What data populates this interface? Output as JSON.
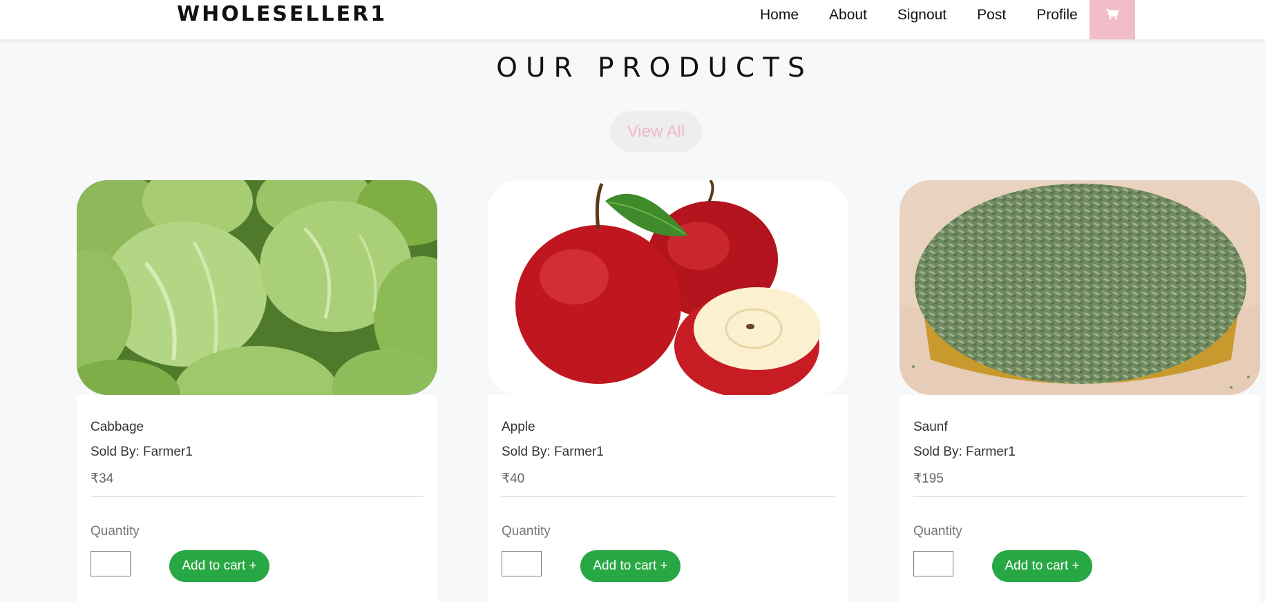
{
  "brand": "WHOLESELLER1",
  "nav": {
    "items": [
      {
        "label": "Home"
      },
      {
        "label": "About"
      },
      {
        "label": "Signout"
      },
      {
        "label": "Post"
      },
      {
        "label": "Profile"
      }
    ],
    "cart_icon": "cart-icon",
    "cart_bg": "#f2bcc8"
  },
  "section": {
    "title": "OUR PRODUCTS",
    "view_all": "View All"
  },
  "colors": {
    "add_button": "#28a745",
    "background": "#f7f8fa"
  },
  "products": [
    {
      "name": "Cabbage",
      "seller": "Sold By: Farmer1",
      "price": "₹34",
      "quantity_label": "Quantity",
      "quantity_value": "",
      "add_label": "Add to cart +",
      "image_icon": "cabbage-image"
    },
    {
      "name": "Apple",
      "seller": "Sold By: Farmer1",
      "price": "₹40",
      "quantity_label": "Quantity",
      "quantity_value": "",
      "add_label": "Add to cart +",
      "image_icon": "apple-image"
    },
    {
      "name": "Saunf",
      "seller": "Sold By: Farmer1",
      "price": "₹195",
      "quantity_label": "Quantity",
      "quantity_value": "",
      "add_label": "Add to cart +",
      "image_icon": "fennel-seeds-image"
    }
  ]
}
